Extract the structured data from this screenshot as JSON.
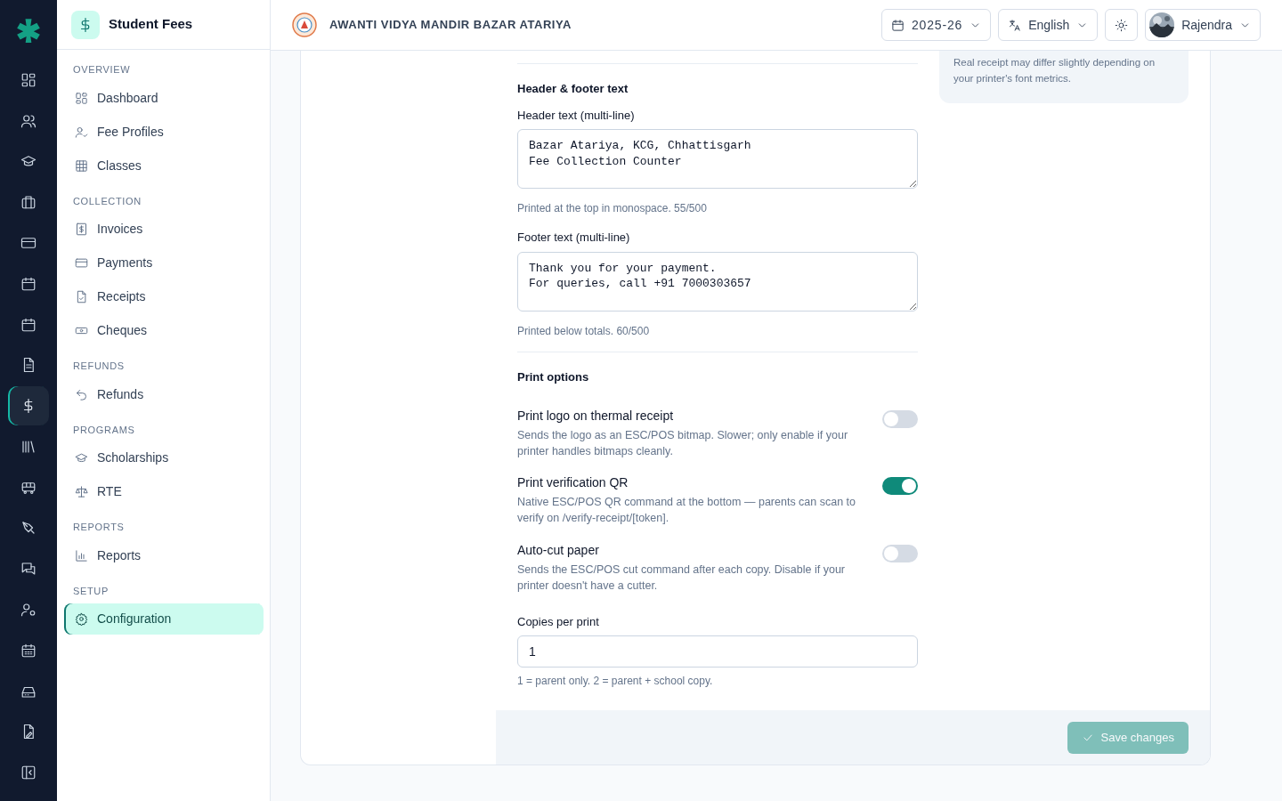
{
  "rail": {
    "items": [
      {
        "selected": false
      },
      {
        "selected": false
      },
      {
        "selected": false
      },
      {
        "selected": false
      },
      {
        "selected": false
      },
      {
        "selected": false
      },
      {
        "selected": false
      },
      {
        "selected": false
      },
      {
        "selected": true
      },
      {
        "selected": false
      },
      {
        "selected": false
      },
      {
        "selected": false
      },
      {
        "selected": false
      },
      {
        "selected": false
      },
      {
        "selected": false
      },
      {
        "selected": false
      },
      {
        "selected": false
      }
    ]
  },
  "sidebar": {
    "title": "Student Fees",
    "sections": [
      {
        "heading": "OVERVIEW",
        "items": [
          {
            "label": "Dashboard",
            "selected": false
          },
          {
            "label": "Fee Profiles",
            "selected": false
          },
          {
            "label": "Classes",
            "selected": false
          }
        ]
      },
      {
        "heading": "COLLECTION",
        "items": [
          {
            "label": "Invoices",
            "selected": false
          },
          {
            "label": "Payments",
            "selected": false
          },
          {
            "label": "Receipts",
            "selected": false
          },
          {
            "label": "Cheques",
            "selected": false
          }
        ]
      },
      {
        "heading": "REFUNDS",
        "items": [
          {
            "label": "Refunds",
            "selected": false
          }
        ]
      },
      {
        "heading": "PROGRAMS",
        "items": [
          {
            "label": "Scholarships",
            "selected": false
          },
          {
            "label": "RTE",
            "selected": false
          }
        ]
      },
      {
        "heading": "REPORTS",
        "items": [
          {
            "label": "Reports",
            "selected": false
          }
        ]
      },
      {
        "heading": "SETUP",
        "items": [
          {
            "label": "Configuration",
            "selected": true
          }
        ]
      }
    ]
  },
  "header": {
    "school": "AWANTI VIDYA MANDIR BAZAR ATARIYA",
    "year": "2025-26",
    "language": "English",
    "user": "Rajendra"
  },
  "preview_note": "Real receipt may differ slightly depending on your printer's font metrics.",
  "form": {
    "text_section": {
      "title": "Header & footer text",
      "fields": [
        {
          "label": "Header text (multi-line)",
          "value": "Bazar Atariya, KCG, Chhattisgarh\nFee Collection Counter",
          "help": "Printed at the top in monospace. 55/500"
        },
        {
          "label": "Footer text (multi-line)",
          "value": "Thank you for your payment.\nFor queries, call +91 7000303657",
          "help": "Printed below totals. 60/500"
        }
      ]
    },
    "print_section": {
      "title": "Print options",
      "toggles": [
        {
          "title": "Print logo on thermal receipt",
          "description": "Sends the logo as an ESC/POS bitmap. Slower; only enable if your printer handles bitmaps cleanly.",
          "on": false
        },
        {
          "title": "Print verification QR",
          "description": "Native ESC/POS QR command at the bottom — parents can scan to verify on /verify-receipt/[token].",
          "on": true
        },
        {
          "title": "Auto-cut paper",
          "description": "Sends the ESC/POS cut command after each copy. Disable if your printer doesn't have a cutter.",
          "on": false
        }
      ],
      "copies": {
        "label": "Copies per print",
        "value": "1",
        "help": "1 = parent only. 2 = parent + school copy."
      }
    }
  },
  "save_button": {
    "label": "Save changes",
    "disabled": true
  }
}
